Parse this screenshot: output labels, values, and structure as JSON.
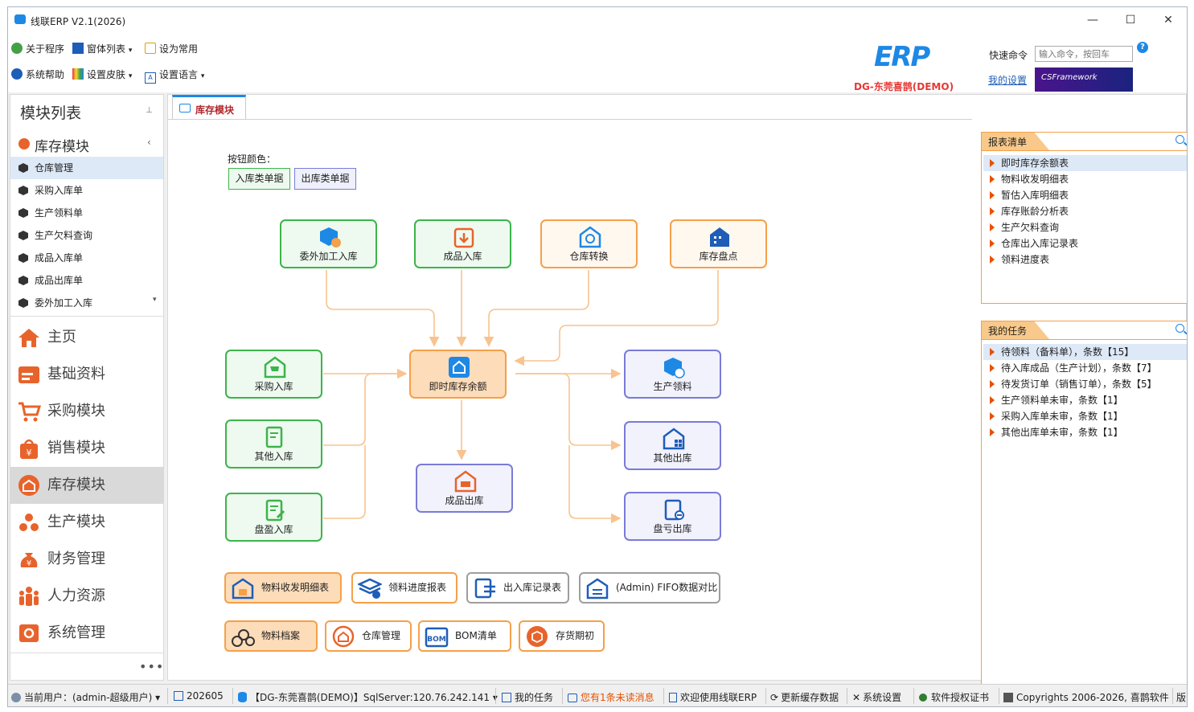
{
  "window": {
    "title": "线联ERP V2.1(2026)"
  },
  "ribbon": {
    "about": "关于程序",
    "window_list": "窗体列表",
    "set_common": "设为常用",
    "help": "系统帮助",
    "skin": "设置皮肤",
    "language": "设置语言",
    "logo_text": "ERP",
    "company": "DG-东莞喜鹊(DEMO)",
    "quick_cmd_label": "快速命令",
    "quick_cmd_placeholder": "输入命令，按回车",
    "my_settings": "我的设置",
    "framework": "CSFramework"
  },
  "left": {
    "title": "模块列表",
    "group": "库存模块",
    "subitems": [
      "仓库管理",
      "采购入库单",
      "生产领料单",
      "生产欠料查询",
      "成品入库单",
      "成品出库单",
      "委外加工入库"
    ],
    "nav": [
      "主页",
      "基础资料",
      "采购模块",
      "销售模块",
      "库存模块",
      "生产模块",
      "财务管理",
      "人力资源",
      "系统管理"
    ],
    "more": "•••"
  },
  "tab": {
    "label": "库存模块"
  },
  "legend": {
    "label": "按钮颜色：",
    "in": "入库类单据",
    "out": "出库类单据"
  },
  "flow": {
    "outsource_in": "委外加工入库",
    "finished_in": "成品入库",
    "transfer": "仓库转换",
    "inventory_check": "库存盘点",
    "purchase_in": "采购入库",
    "other_in": "其他入库",
    "surplus_in": "盘盈入库",
    "balance": "即时库存余额",
    "finished_out": "成品出库",
    "production_pick": "生产领料",
    "other_out": "其他出库",
    "loss_out": "盘亏出库"
  },
  "reports": {
    "material_detail": "物料收发明细表",
    "pick_progress": "领料进度报表",
    "io_records": "出入库记录表",
    "fifo": "(Admin) FIFO数据对比",
    "material_file": "物料档案",
    "warehouse": "仓库管理",
    "bom": "BOM清单",
    "opening": "存货期初"
  },
  "report_list": {
    "title": "报表清单",
    "items": [
      "即时库存余额表",
      "物料收发明细表",
      "暂估入库明细表",
      "库存账龄分析表",
      "生产欠料查询",
      "仓库出入库记录表",
      "领料进度表"
    ]
  },
  "task_list": {
    "title": "我的任务",
    "items": [
      "待领料（备料单），条数【15】",
      "待入库成品（生产计划），条数【7】",
      "待发货订单（销售订单），条数【5】",
      "生产领料单未审，条数【1】",
      "采购入库单未审，条数【1】",
      "其他出库单未审，条数【1】"
    ]
  },
  "status": {
    "user": "当前用户：(admin-超级用户)",
    "period": "202605",
    "db": "【DG-东莞喜鹊(DEMO)】SqlServer:120.76.242.141",
    "tasks": "我的任务",
    "messages": "您有1条未读消息",
    "welcome": "欢迎使用线联ERP",
    "refresh_cache": "更新缓存数据",
    "sys_settings": "系统设置",
    "license": "软件授权证书",
    "copyright": "Copyrights 2006-2026, 喜鹊软件",
    "version": "版"
  },
  "colors": {
    "accent": "#1e88e5",
    "orange": "#f5a04a",
    "green": "#3cb44a",
    "purple": "#7a7ad8",
    "red": "#b0282e"
  }
}
